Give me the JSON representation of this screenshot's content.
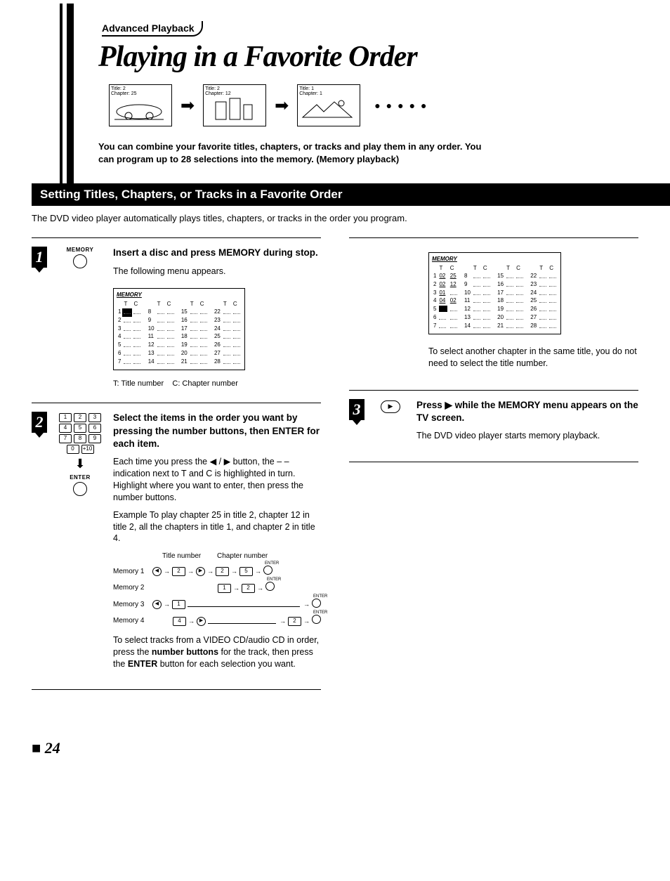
{
  "header": {
    "section": "Advanced Playback",
    "title": "Playing in a Favorite Order",
    "thumb1_title": "Title: 2",
    "thumb1_chapter": "Chapter: 25",
    "thumb2_title": "Title: 2",
    "thumb2_chapter": "Chapter: 12",
    "thumb3_title": "Title: 1",
    "thumb3_chapter": "Chapter: 1",
    "intro": "You can combine your favorite titles, chapters, or tracks and play them in any order. You can program up to 28 selections into the memory. (Memory playback)"
  },
  "section_bar": "Setting Titles, Chapters, or Tracks in a Favorite Order",
  "sub_intro": "The DVD video player automatically plays titles, chapters, or tracks in the order you program.",
  "step1": {
    "num": "1",
    "remote_label": "MEMORY",
    "title": "Insert a disc and press MEMORY during stop.",
    "desc": "The following menu appears.",
    "table_header": "MEMORY",
    "col_t": "T",
    "col_c": "C",
    "rows": [
      [
        "1",
        "8",
        "15",
        "22"
      ],
      [
        "2",
        "9",
        "16",
        "23"
      ],
      [
        "3",
        "10",
        "17",
        "24"
      ],
      [
        "4",
        "11",
        "18",
        "25"
      ],
      [
        "5",
        "12",
        "19",
        "26"
      ],
      [
        "6",
        "13",
        "20",
        "27"
      ],
      [
        "7",
        "14",
        "21",
        "28"
      ]
    ],
    "legend_t": "T: Title number",
    "legend_c": "C: Chapter number"
  },
  "step2": {
    "num": "2",
    "remote_enter": "ENTER",
    "title": "Select the items in the order you want by pressing the number buttons, then ENTER for each item.",
    "para1": "Each time you press the ◀ / ▶ button, the – – indication next to T and C is highlighted in turn. Highlight where you want to enter, then press the number buttons.",
    "example_lead": "Example",
    "example": "To play chapter 25 in title 2, chapter 12 in title 2, all the chapters in title 1, and chapter 2 in title 4.",
    "hdr_title": "Title number",
    "hdr_chapter": "Chapter number",
    "m1": "Memory 1",
    "m2": "Memory 2",
    "m3": "Memory 3",
    "m4": "Memory 4",
    "enter": "ENTER",
    "para2a": "To select tracks from a VIDEO CD/audio CD in order, press the ",
    "para2b": "number buttons",
    "para2c": " for the track, then press the ",
    "para2d": "ENTER",
    "para2e": " button for each selection you want."
  },
  "col2": {
    "table_header": "MEMORY",
    "col_t": "T",
    "col_c": "C",
    "rows": [
      {
        "n": "1",
        "t": "02",
        "c": "25"
      },
      {
        "n": "2",
        "t": "02",
        "c": "12"
      },
      {
        "n": "3",
        "t": "01",
        "c": "--"
      },
      {
        "n": "4",
        "t": "04",
        "c": "02"
      },
      {
        "n": "5",
        "t": "--",
        "c": "--",
        "hi": true
      },
      {
        "n": "6",
        "t": "--",
        "c": "--"
      },
      {
        "n": "7",
        "t": "--",
        "c": "--"
      }
    ],
    "note": "To select another chapter in the same title, you do not need to select the title number."
  },
  "step3": {
    "num": "3",
    "title_a": "Press ▶ while the MEMORY menu appears on the TV screen.",
    "desc": "The DVD video player starts memory playback."
  },
  "page_number": "24",
  "numpad": [
    "1",
    "2",
    "3",
    "4",
    "5",
    "6",
    "7",
    "8",
    "9",
    "0",
    "+10"
  ]
}
